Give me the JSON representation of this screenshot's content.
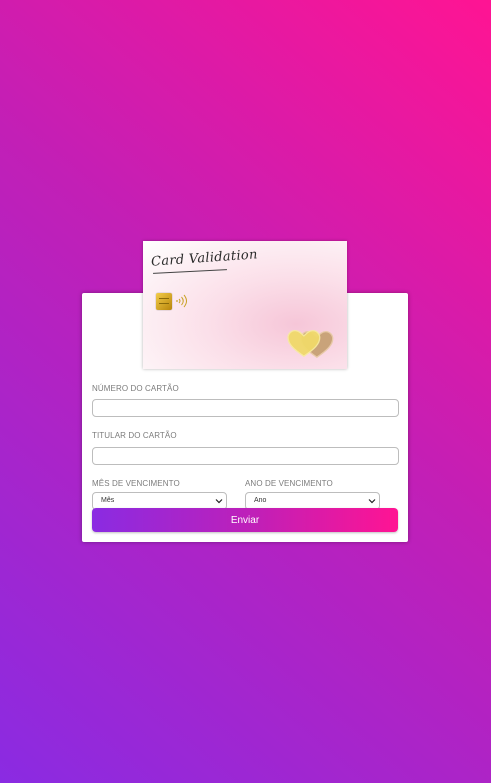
{
  "card": {
    "title": "Card Validation",
    "chip_icon": "chip-icon",
    "contactless_icon": "contactless-icon",
    "decoration_icon": "hearts-icon"
  },
  "form": {
    "card_number": {
      "label": "NÚMERO DO CARTÃO",
      "value": "",
      "placeholder": ""
    },
    "card_holder": {
      "label": "TITULAR DO CARTÃO",
      "value": "",
      "placeholder": ""
    },
    "expiry_month": {
      "label": "MÊS DE VENCIMENTO",
      "selected": "Mês"
    },
    "expiry_year": {
      "label": "ANO DE VENCIMENTO",
      "selected": "Ano"
    },
    "submit_label": "Enviar"
  },
  "colors": {
    "gradient_start": "#8a2be2",
    "gradient_end": "#ff1493",
    "panel": "#ffffff"
  }
}
